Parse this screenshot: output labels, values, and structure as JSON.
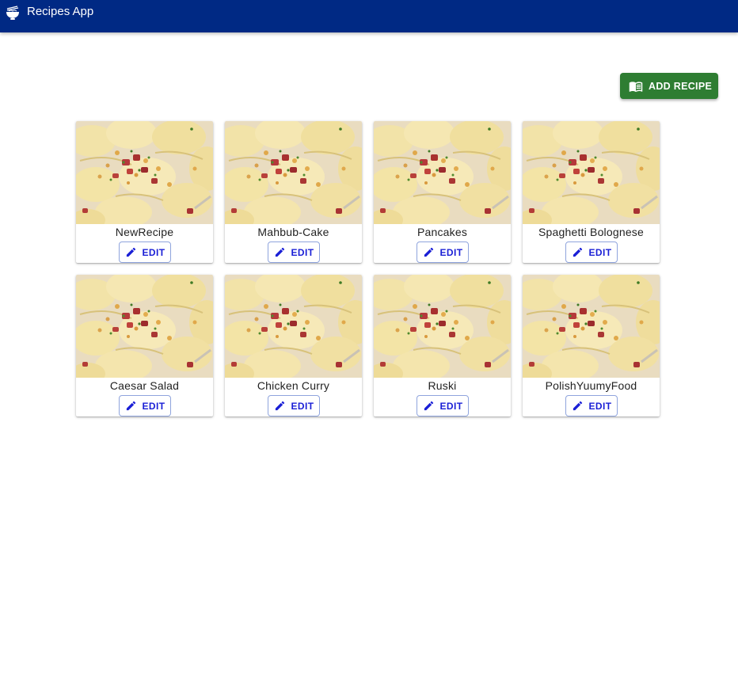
{
  "app": {
    "title": "Recipes App",
    "logo_icon": "ramen-bowl-icon",
    "appbar_color": "#002984"
  },
  "toolbar": {
    "add_label": "ADD RECIPE",
    "add_icon": "menu-book-icon",
    "add_color": "#2e7d32"
  },
  "recipes": [
    {
      "title": "NewRecipe",
      "edit_label": "EDIT",
      "edit_icon": "pencil-icon",
      "image": "pierogi-photo"
    },
    {
      "title": "Mahbub-Cake",
      "edit_label": "EDIT",
      "edit_icon": "pencil-icon",
      "image": "pierogi-photo"
    },
    {
      "title": "Pancakes",
      "edit_label": "EDIT",
      "edit_icon": "pencil-icon",
      "image": "pierogi-photo"
    },
    {
      "title": "Spaghetti Bolognese",
      "edit_label": "EDIT",
      "edit_icon": "pencil-icon",
      "image": "pierogi-photo"
    },
    {
      "title": "Caesar Salad",
      "edit_label": "EDIT",
      "edit_icon": "pencil-icon",
      "image": "pierogi-photo"
    },
    {
      "title": "Chicken Curry",
      "edit_label": "EDIT",
      "edit_icon": "pencil-icon",
      "image": "pierogi-photo"
    },
    {
      "title": "Ruski",
      "edit_label": "EDIT",
      "edit_icon": "pencil-icon",
      "image": "pierogi-photo"
    },
    {
      "title": "PolishYuumyFood",
      "edit_label": "EDIT",
      "edit_icon": "pencil-icon",
      "image": "pierogi-photo"
    }
  ]
}
